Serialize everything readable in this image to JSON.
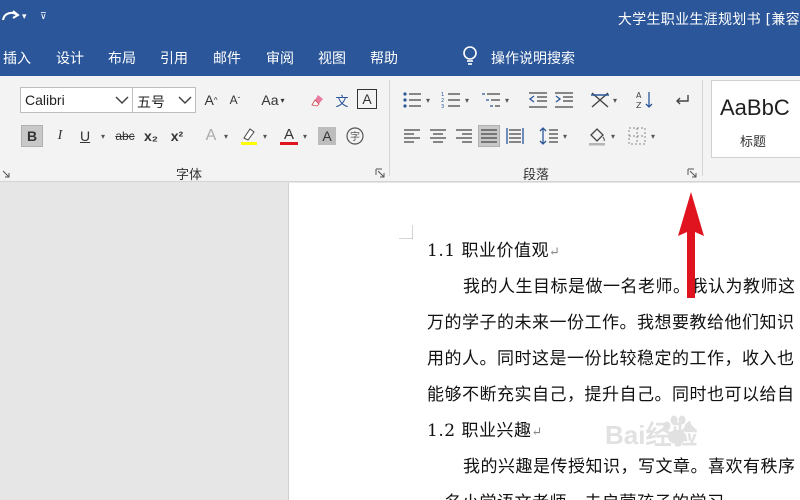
{
  "titlebar": {
    "doc_title": "大学生职业生涯规划书 [兼容",
    "bg_color": "#2b579a"
  },
  "tabs": {
    "items": [
      "插入",
      "设计",
      "布局",
      "引用",
      "邮件",
      "审阅",
      "视图",
      "帮助"
    ],
    "tell_me": "操作说明搜索"
  },
  "ribbon": {
    "font_name": "Calibri",
    "font_size": "五号",
    "grow_font": "A",
    "shrink_font": "A",
    "change_case": "Aa",
    "phonetic_guide": "文",
    "bold": "B",
    "italic": "I",
    "underline": "U",
    "strikethrough": "abc",
    "subscript": "x₂",
    "superscript": "x²",
    "font_color_letter": "A",
    "shading_letter": "A",
    "enclose_char": "字",
    "font_group_label": "字体",
    "paragraph_group_label": "段落",
    "style_sample": "AaBbC",
    "style_name": "标题"
  },
  "document": {
    "lines": [
      "1.1 职业价值观",
      "我的人生目标是做一名老师。我认为教师这",
      "万的学子的未来一份工作。我想要教给他们知识",
      "用的人。同时这是一份比较稳定的工作，收入也",
      "能够不断充实自己，提升自己。同时也可以给自",
      "1.2 职业兴趣",
      "我的兴趣是传授知识，写文章。喜欢有秩序",
      "一名小学语文老师，去启蒙孩子的学习。"
    ],
    "para_mark": "↵"
  },
  "annotation": {
    "arrow_color": "#e0141e"
  },
  "watermark": {
    "text": "Bai经验"
  }
}
